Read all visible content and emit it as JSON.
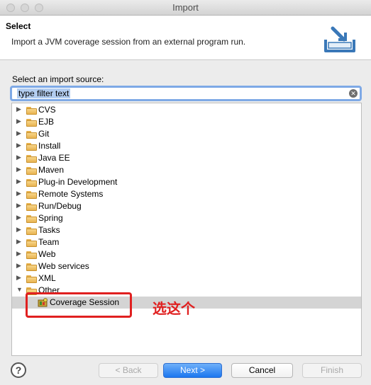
{
  "window": {
    "title": "Import"
  },
  "banner": {
    "title": "Select",
    "description": "Import a JVM coverage session from an external program run."
  },
  "source": {
    "label": "Select an import source:",
    "filter_placeholder": "type filter text"
  },
  "tree": {
    "items": [
      {
        "label": "CVS",
        "expanded": false
      },
      {
        "label": "EJB",
        "expanded": false
      },
      {
        "label": "Git",
        "expanded": false
      },
      {
        "label": "Install",
        "expanded": false
      },
      {
        "label": "Java EE",
        "expanded": false
      },
      {
        "label": "Maven",
        "expanded": false
      },
      {
        "label": "Plug-in Development",
        "expanded": false
      },
      {
        "label": "Remote Systems",
        "expanded": false
      },
      {
        "label": "Run/Debug",
        "expanded": false
      },
      {
        "label": "Spring",
        "expanded": false
      },
      {
        "label": "Tasks",
        "expanded": false
      },
      {
        "label": "Team",
        "expanded": false
      },
      {
        "label": "Web",
        "expanded": false
      },
      {
        "label": "Web services",
        "expanded": false
      },
      {
        "label": "XML",
        "expanded": false
      },
      {
        "label": "Other",
        "expanded": true
      }
    ],
    "child": {
      "label": "Coverage Session",
      "selected": true
    }
  },
  "annotation": {
    "text": "选这个",
    "color": "#e02020"
  },
  "buttons": {
    "back": "< Back",
    "next": "Next >",
    "cancel": "Cancel",
    "finish": "Finish"
  },
  "icons": {
    "help": "help-icon",
    "clear": "clear-search-icon",
    "folder": "folder-icon",
    "coverage": "coverage-session-icon",
    "import": "import-wizard-icon"
  }
}
